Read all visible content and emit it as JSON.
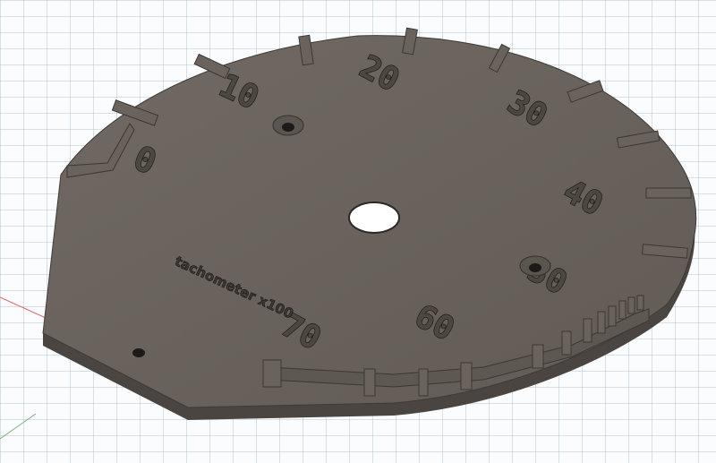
{
  "viewport": {
    "background": "#fbfcfd",
    "axis_colors": {
      "x_axis": "#e06060",
      "y_axis": "#7ab07a"
    }
  },
  "dial": {
    "face_color": "#6b645e",
    "edge_color": "#4a4540",
    "numerals": [
      "0",
      "10",
      "20",
      "30",
      "40",
      "50",
      "60",
      "70"
    ],
    "label": "tachometer x100",
    "center_hole": "center-hole",
    "mount_holes": 3
  }
}
